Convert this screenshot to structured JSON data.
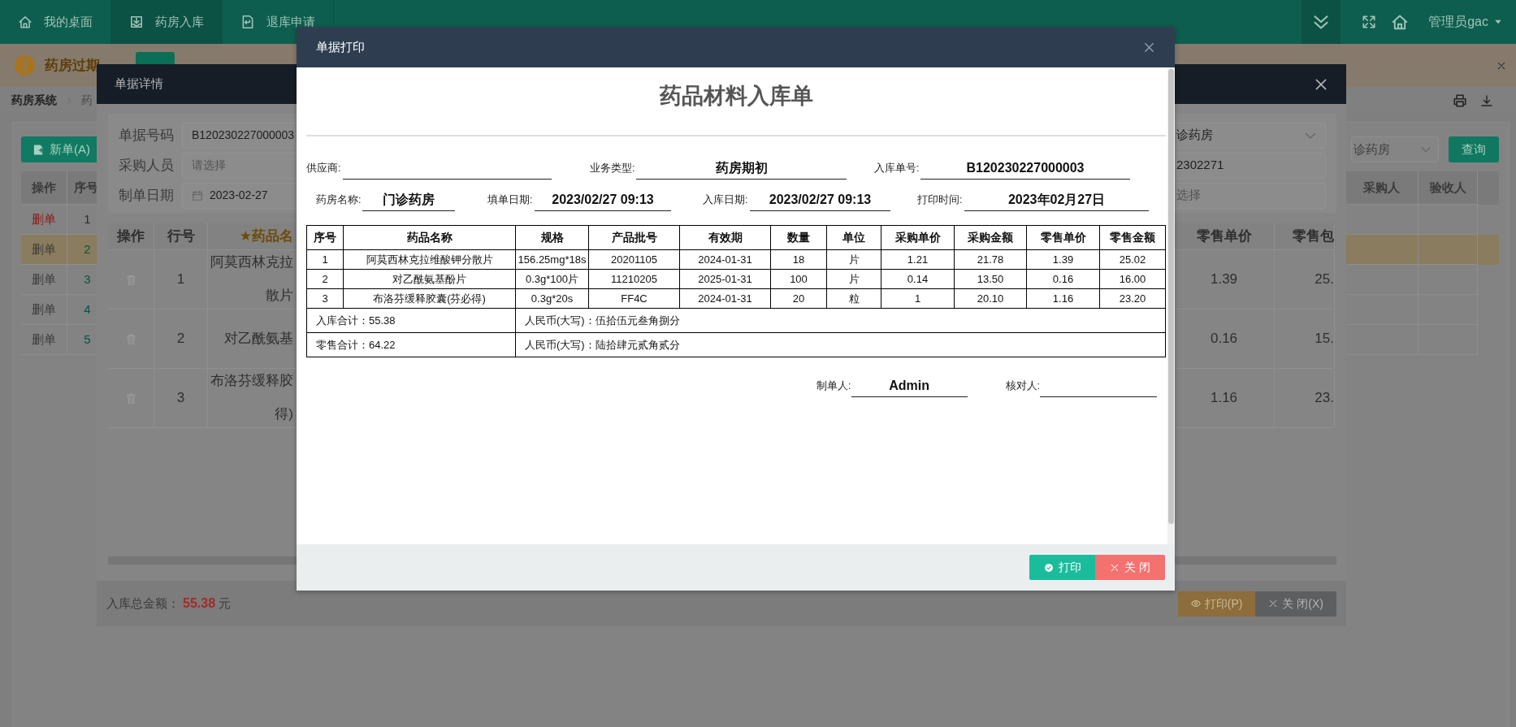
{
  "top_bar": {
    "tabs": [
      {
        "label": "我的桌面",
        "selected": false
      },
      {
        "label": "药房入库",
        "selected": true
      },
      {
        "label": "退库申请",
        "selected": false
      }
    ],
    "user": "管理员gac"
  },
  "alert": {
    "text": "药房过期"
  },
  "breadcrumb": [
    "药房系统",
    "药"
  ],
  "page": {
    "new_button": "新单(A)",
    "store_select": "诊药房",
    "query_button": "查询",
    "table": {
      "columns_left": [
        "操作",
        "序号"
      ],
      "columns_right": [
        "采购人",
        "验收人"
      ],
      "rows": [
        {
          "action": "删单",
          "no": "1",
          "disabled": false,
          "selected": false
        },
        {
          "action": "删单",
          "no": "2",
          "disabled": true,
          "selected": true
        },
        {
          "action": "删单",
          "no": "3",
          "disabled": true,
          "selected": false
        },
        {
          "action": "删单",
          "no": "4",
          "disabled": true,
          "selected": false
        },
        {
          "action": "删单",
          "no": "5",
          "disabled": true,
          "selected": false
        }
      ]
    }
  },
  "detail_dialog": {
    "title": "单据详情",
    "form": {
      "left": [
        {
          "label": "单据号码",
          "value": "B120230227000003"
        },
        {
          "label": "采购人员",
          "placeholder": "请选择"
        },
        {
          "label": "制单日期",
          "value": "2023-02-27",
          "kind": "date"
        }
      ],
      "right": [
        {
          "value": "诊药房",
          "kind": "select"
        },
        {
          "value": "2302271",
          "kind": "text"
        },
        {
          "placeholder": "选择",
          "kind": "text"
        }
      ]
    },
    "table": {
      "columns_left": [
        "操作",
        "行号",
        "★药品名"
      ],
      "columns_right": [
        "零售单价",
        "零售包"
      ],
      "rows": [
        {
          "line": "1",
          "name": [
            "阿莫西林克拉",
            "散片"
          ],
          "retail_price": "1.39",
          "retail_pack": "25."
        },
        {
          "line": "2",
          "name": [
            "对乙酰氨基"
          ],
          "retail_price": "0.16",
          "retail_pack": "15."
        },
        {
          "line": "3",
          "name": [
            "布洛芬缓释胶",
            "得)"
          ],
          "retail_price": "1.16",
          "retail_pack": "23."
        }
      ]
    },
    "total_label": "入库总金额：",
    "total": "55.38",
    "unit": "元",
    "buttons": [
      {
        "label": "打印(P)",
        "kind": "print"
      },
      {
        "label": "关 闭(X)",
        "kind": "close"
      }
    ]
  },
  "print_dialog": {
    "title": "单据打印",
    "doc_title": "药品材料入库单",
    "fields": [
      [
        {
          "label": "供应商:"
        },
        {
          "label": "业务类型:",
          "value": "药房期初"
        },
        {
          "label": "入库单号:",
          "value": "B120230227000003"
        }
      ],
      [
        {
          "label": "药房名称:",
          "value": "门诊药房"
        },
        {
          "label": "填单日期:",
          "value": "2023/02/27 09:13"
        },
        {
          "label": "入库日期:",
          "value": "2023/02/27 09:13"
        },
        {
          "label": "打印时间:",
          "value": "2023年02月27日"
        }
      ]
    ],
    "table": {
      "columns": [
        "序号",
        "药品名称",
        "规格",
        "产品批号",
        "有效期",
        "数量",
        "单位",
        "采购单价",
        "采购金额",
        "零售单价",
        "零售金额"
      ],
      "rows": [
        [
          "1",
          "阿莫西林克拉维酸钾分散片",
          "156.25mg*18s",
          "20201105",
          "2024-01-31",
          "18",
          "片",
          "1.21",
          "21.78",
          "1.39",
          "25.02"
        ],
        [
          "2",
          "对乙酰氨基酚片",
          "0.3g*100片",
          "11210205",
          "2025-01-31",
          "100",
          "片",
          "0.14",
          "13.50",
          "0.16",
          "16.00"
        ],
        [
          "3",
          "布洛芬缓释胶囊(芬必得)",
          "0.3g*20s",
          "FF4C",
          "2024-01-31",
          "20",
          "粒",
          "1",
          "20.10",
          "1.16",
          "23.20"
        ]
      ],
      "summary": [
        {
          "label": "入库合计：55.38",
          "words": "人民币(大写)：伍拾伍元叁角捌分"
        },
        {
          "label": "零售合计：64.22",
          "words": "人民币(大写)：陆拾肆元贰角贰分"
        }
      ]
    },
    "signatures": [
      {
        "label": "制单人:",
        "value": "Admin"
      },
      {
        "label": "核对人:"
      }
    ],
    "buttons": [
      {
        "label": "打印",
        "kind": "print"
      },
      {
        "label": "关 闭",
        "kind": "close"
      }
    ]
  }
}
